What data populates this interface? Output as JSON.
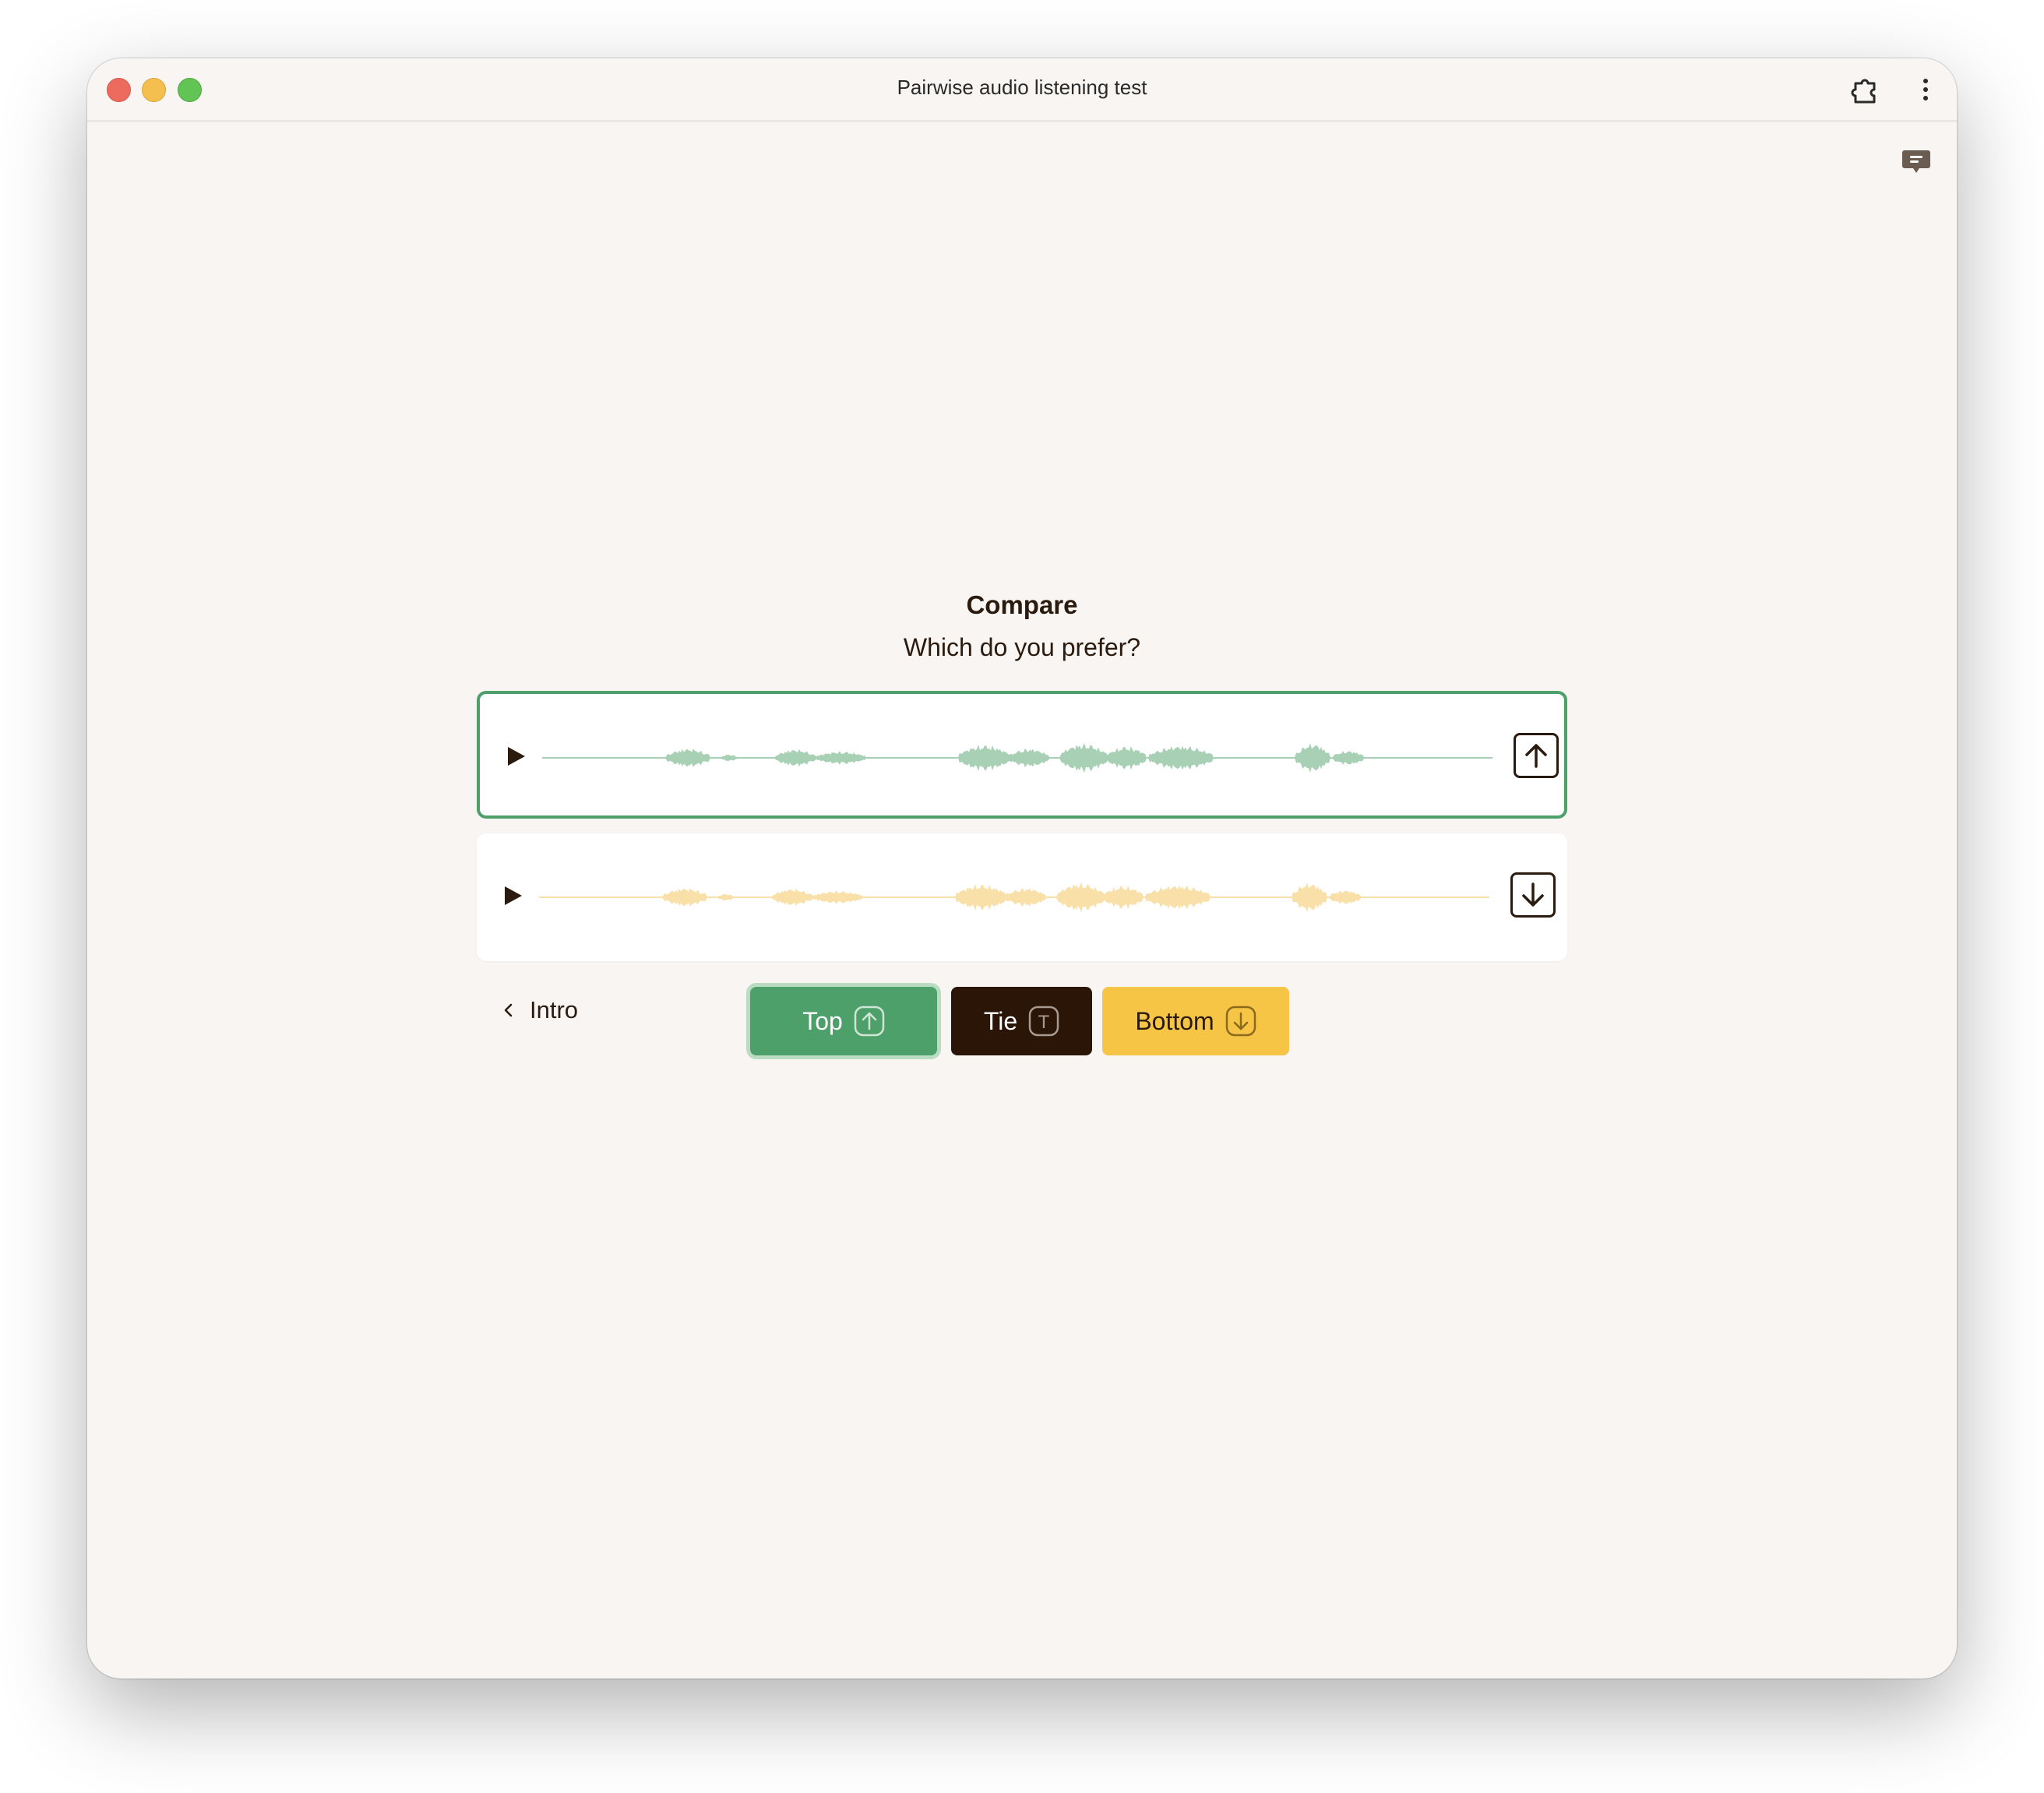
{
  "window": {
    "title": "Pairwise audio listening test"
  },
  "icons": {
    "extension": "puzzle-piece-icon",
    "menu": "vertical-ellipsis-icon",
    "feedback": "chat-bubble-icon",
    "play": "play-icon",
    "up": "arrow-up-icon",
    "down": "arrow-down-icon",
    "back": "chevron-left-icon"
  },
  "main": {
    "heading": "Compare",
    "prompt": "Which do you prefer?"
  },
  "samples": [
    {
      "position": "top",
      "selected": true,
      "wave_color": "#a8d0b5",
      "border_color": "#4ea06a"
    },
    {
      "position": "bottom",
      "selected": false,
      "wave_color": "#f8e0a8"
    }
  ],
  "nav": {
    "back_label": "Intro"
  },
  "choices": {
    "top_label": "Top",
    "top_key": "up-arrow-key-icon",
    "tie_label": "Tie",
    "tie_key": "T",
    "bottom_label": "Bottom",
    "bottom_key": "down-arrow-key-icon"
  },
  "colors": {
    "background": "#f8f5f2",
    "green": "#4ea06a",
    "dark": "#2b1507",
    "yellow": "#f6c545",
    "text": "#2b1a0e"
  }
}
